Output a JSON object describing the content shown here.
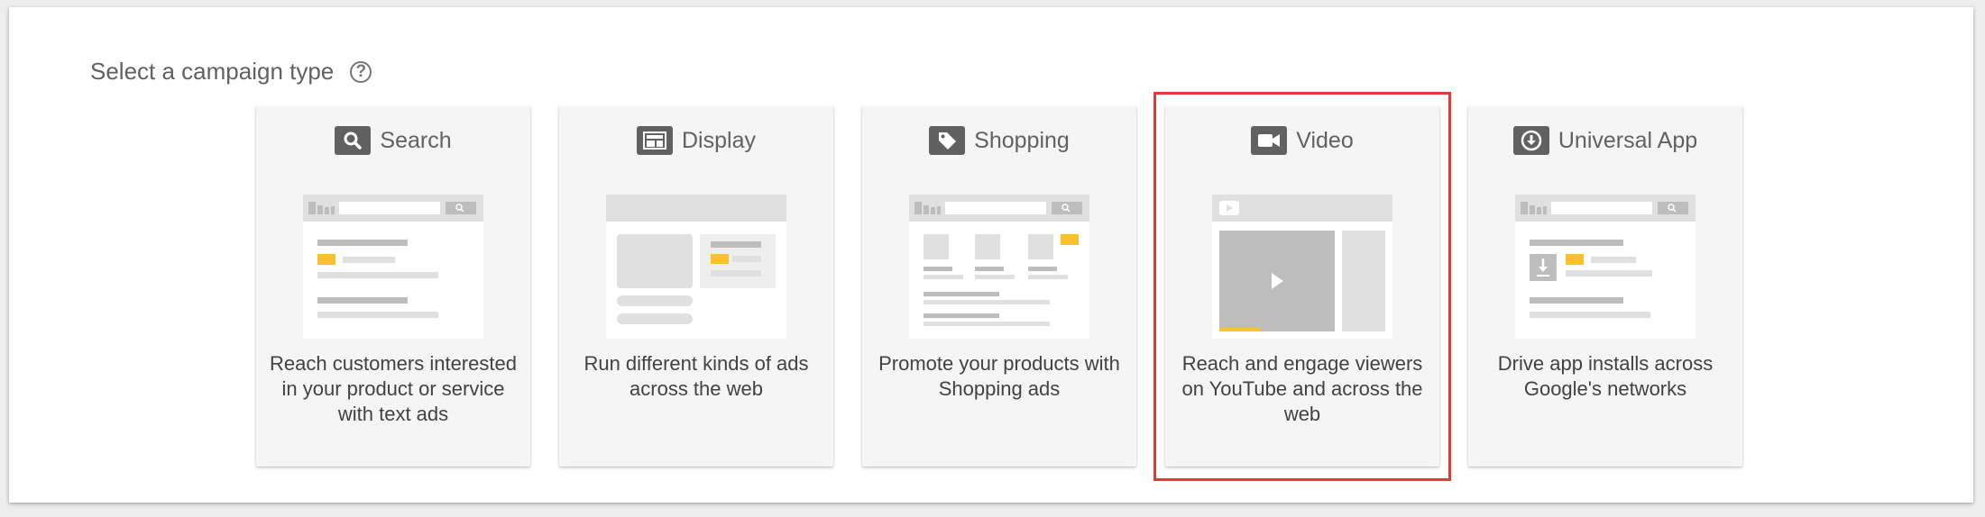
{
  "heading": {
    "text": "Select a campaign type",
    "help_icon": "help-circle-icon",
    "help_glyph": "?"
  },
  "cards": [
    {
      "label": "Search",
      "icon": "search-icon",
      "description": "Reach customers interested in your product or service with text ads"
    },
    {
      "label": "Display",
      "icon": "display-icon",
      "description": "Run different kinds of ads across the web"
    },
    {
      "label": "Shopping",
      "icon": "tag-icon",
      "description": "Promote your products with Shopping ads"
    },
    {
      "label": "Video",
      "icon": "video-camera-icon",
      "description": "Reach and engage viewers on YouTube and across the web",
      "selected": true
    },
    {
      "label": "Universal App",
      "icon": "download-icon",
      "description": "Drive app installs across Google's networks"
    }
  ],
  "colors": {
    "accent": "#fbc02d",
    "selection_outline": "#e53935",
    "icon": "#616161"
  }
}
